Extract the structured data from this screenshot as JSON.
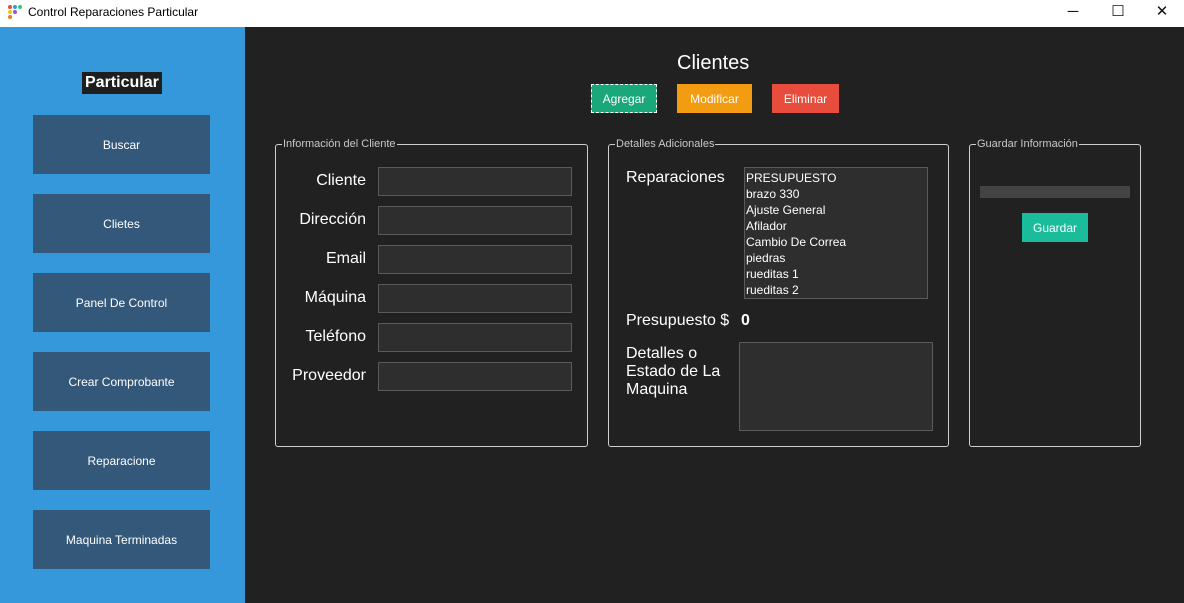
{
  "window": {
    "title": "Control Reparaciones Particular",
    "minimize_glyph": "─",
    "maximize_glyph": "☐",
    "close_glyph": "✕"
  },
  "sidebar": {
    "brand": "Particular",
    "items": [
      {
        "label": "Buscar"
      },
      {
        "label": "Clietes"
      },
      {
        "label": "Panel De Control"
      },
      {
        "label": "Crear Comprobante"
      },
      {
        "label": "Reparacione"
      },
      {
        "label": "Maquina Terminadas"
      }
    ]
  },
  "main": {
    "title": "Clientes",
    "actions": {
      "add_label": "Agregar",
      "modify_label": "Modificar",
      "delete_label": "Eliminar"
    }
  },
  "client_info": {
    "legend": "Información del Cliente",
    "fields": [
      {
        "label": "Cliente",
        "value": ""
      },
      {
        "label": "Dirección",
        "value": ""
      },
      {
        "label": "Email",
        "value": ""
      },
      {
        "label": "Máquina",
        "value": ""
      },
      {
        "label": "Teléfono",
        "value": ""
      },
      {
        "label": "Proveedor",
        "value": ""
      }
    ]
  },
  "details": {
    "legend": "Detalles Adicionales",
    "repairs_label": "Reparaciones",
    "repairs_list": [
      "PRESUPUESTO",
      "brazo 330",
      "Ajuste General",
      "Afilador",
      "Cambio De Correa",
      "piedras",
      "rueditas 1",
      "rueditas 2"
    ],
    "budget_label": "Presupuesto $",
    "budget_value": "0",
    "notes_label_lines": [
      "Detalles o",
      "Estado de La",
      "Maquina"
    ],
    "notes_value": ""
  },
  "save": {
    "legend": "Guardar Información",
    "progress": 0,
    "button_label": "Guardar"
  },
  "colors": {
    "sidebar_bg": "#3498db",
    "nav_button_bg": "#34587a",
    "content_bg": "#212121",
    "add": "#1aa87a",
    "modify": "#f39c12",
    "delete": "#e74c3c",
    "save": "#1abc9c"
  }
}
